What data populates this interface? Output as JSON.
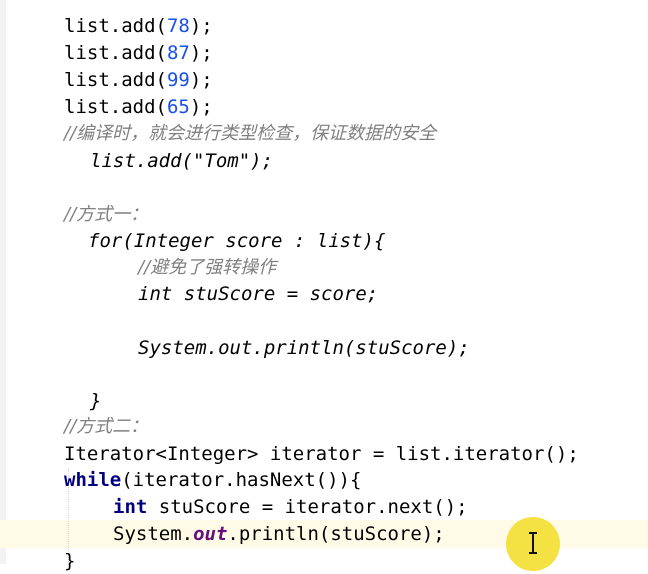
{
  "code": {
    "l1": {
      "pre": "list.add(",
      "num": "78",
      "post": ");"
    },
    "l2": {
      "pre": "list.add(",
      "num": "87",
      "post": ");"
    },
    "l3": {
      "pre": "list.add(",
      "num": "99",
      "post": ");"
    },
    "l4": {
      "pre": "list.add(",
      "num": "65",
      "post": ");"
    },
    "c1": "//编译时，就会进行类型检查，保证数据的安全",
    "l5": "list.add(\"Tom\");",
    "c2": "//方式一：",
    "l6": "for(Integer score : list){",
    "c3": "//避免了强转操作",
    "l7": "int stuScore = score;",
    "l8": "System.out.println(stuScore);",
    "l9": "}",
    "c4": "//方式二：",
    "l10": "Iterator<Integer> iterator = list.iterator();",
    "l11": {
      "kw": "while",
      "rest": "(iterator.hasNext()){"
    },
    "l12": {
      "kw": "int",
      "rest": " stuScore = iterator.next();"
    },
    "l13": {
      "pre": "System.",
      "field": "out",
      "post": ".println(stuScore);"
    },
    "l14": "}"
  },
  "colors": {
    "keyword": "#000080",
    "number": "#1750eb",
    "comment": "#808080",
    "field": "#660e7a",
    "caret_line": "#fffbe6",
    "cursor_highlight": "#f3e03a"
  },
  "icons": {
    "cursor": "i-beam-cursor-icon"
  }
}
